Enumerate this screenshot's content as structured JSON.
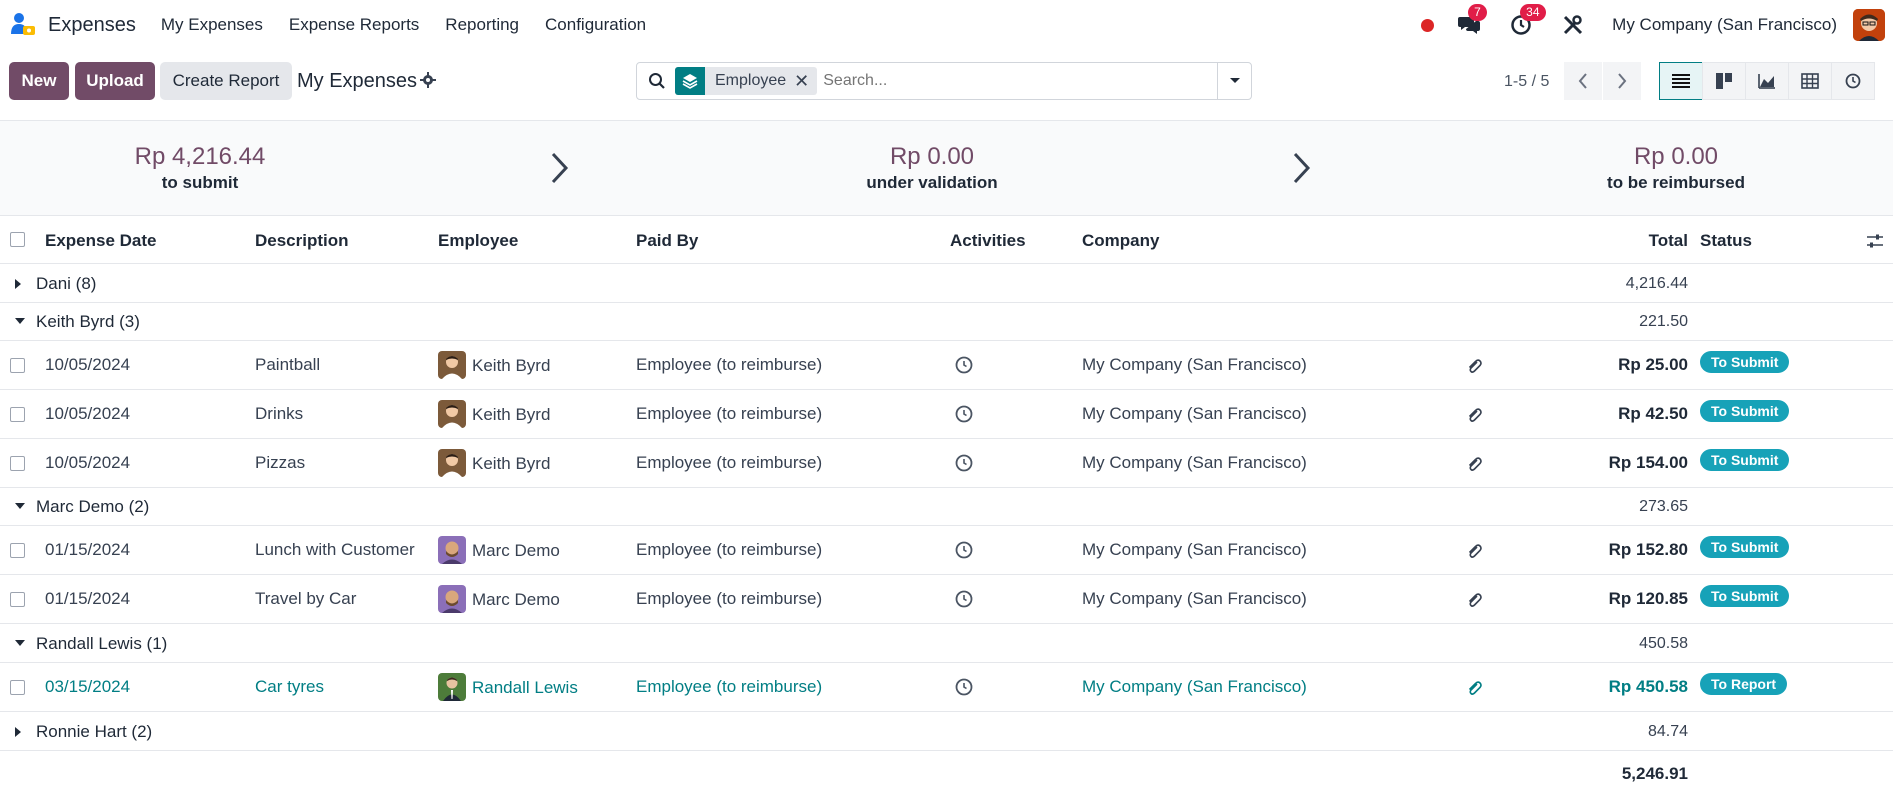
{
  "navbar": {
    "app_name": "Expenses",
    "menu": [
      "My Expenses",
      "Expense Reports",
      "Reporting",
      "Configuration"
    ],
    "messages_badge": "7",
    "activities_badge": "34",
    "company": "My Company (San Francisco)"
  },
  "control": {
    "new_label": "New",
    "upload_label": "Upload",
    "create_report_label": "Create Report",
    "title": "My Expenses",
    "facet_label": "Employee",
    "search_placeholder": "Search...",
    "pager": "1-5 / 5"
  },
  "summary": [
    {
      "amount": "Rp 4,216.44",
      "label": "to submit"
    },
    {
      "amount": "Rp 0.00",
      "label": "under validation"
    },
    {
      "amount": "Rp 0.00",
      "label": "to be reimbursed"
    }
  ],
  "columns": [
    "Expense Date",
    "Description",
    "Employee",
    "Paid By",
    "Activities",
    "Company",
    "Total",
    "Status"
  ],
  "groups": [
    {
      "label": "Dani (8)",
      "total": "4,216.44",
      "expanded": false,
      "rows": []
    },
    {
      "label": "Keith Byrd (3)",
      "total": "221.50",
      "expanded": true,
      "rows": [
        {
          "date": "10/05/2024",
          "description": "Paintball",
          "employee": "Keith Byrd",
          "paid_by": "Employee (to reimburse)",
          "company": "My Company (San Francisco)",
          "total": "Rp 25.00",
          "status": "To Submit"
        },
        {
          "date": "10/05/2024",
          "description": "Drinks",
          "employee": "Keith Byrd",
          "paid_by": "Employee (to reimburse)",
          "company": "My Company (San Francisco)",
          "total": "Rp 42.50",
          "status": "To Submit"
        },
        {
          "date": "10/05/2024",
          "description": "Pizzas",
          "employee": "Keith Byrd",
          "paid_by": "Employee (to reimburse)",
          "company": "My Company (San Francisco)",
          "total": "Rp 154.00",
          "status": "To Submit"
        }
      ]
    },
    {
      "label": "Marc Demo (2)",
      "total": "273.65",
      "expanded": true,
      "rows": [
        {
          "date": "01/15/2024",
          "description": "Lunch with Customer",
          "employee": "Marc Demo",
          "paid_by": "Employee (to reimburse)",
          "company": "My Company (San Francisco)",
          "total": "Rp 152.80",
          "status": "To Submit"
        },
        {
          "date": "01/15/2024",
          "description": "Travel by Car",
          "employee": "Marc Demo",
          "paid_by": "Employee (to reimburse)",
          "company": "My Company (San Francisco)",
          "total": "Rp 120.85",
          "status": "To Submit"
        }
      ]
    },
    {
      "label": "Randall Lewis (1)",
      "total": "450.58",
      "expanded": true,
      "rows": [
        {
          "date": "03/15/2024",
          "description": "Car tyres",
          "employee": "Randall Lewis",
          "paid_by": "Employee (to reimburse)",
          "company": "My Company (San Francisco)",
          "total": "Rp 450.58",
          "status": "To Report"
        }
      ]
    },
    {
      "label": "Ronnie Hart (2)",
      "total": "84.74",
      "expanded": false,
      "rows": []
    }
  ],
  "grand_total": "5,246.91",
  "colors": {
    "primary": "#714b67",
    "teal": "#017e84",
    "status_badge": "#17a2b8"
  }
}
